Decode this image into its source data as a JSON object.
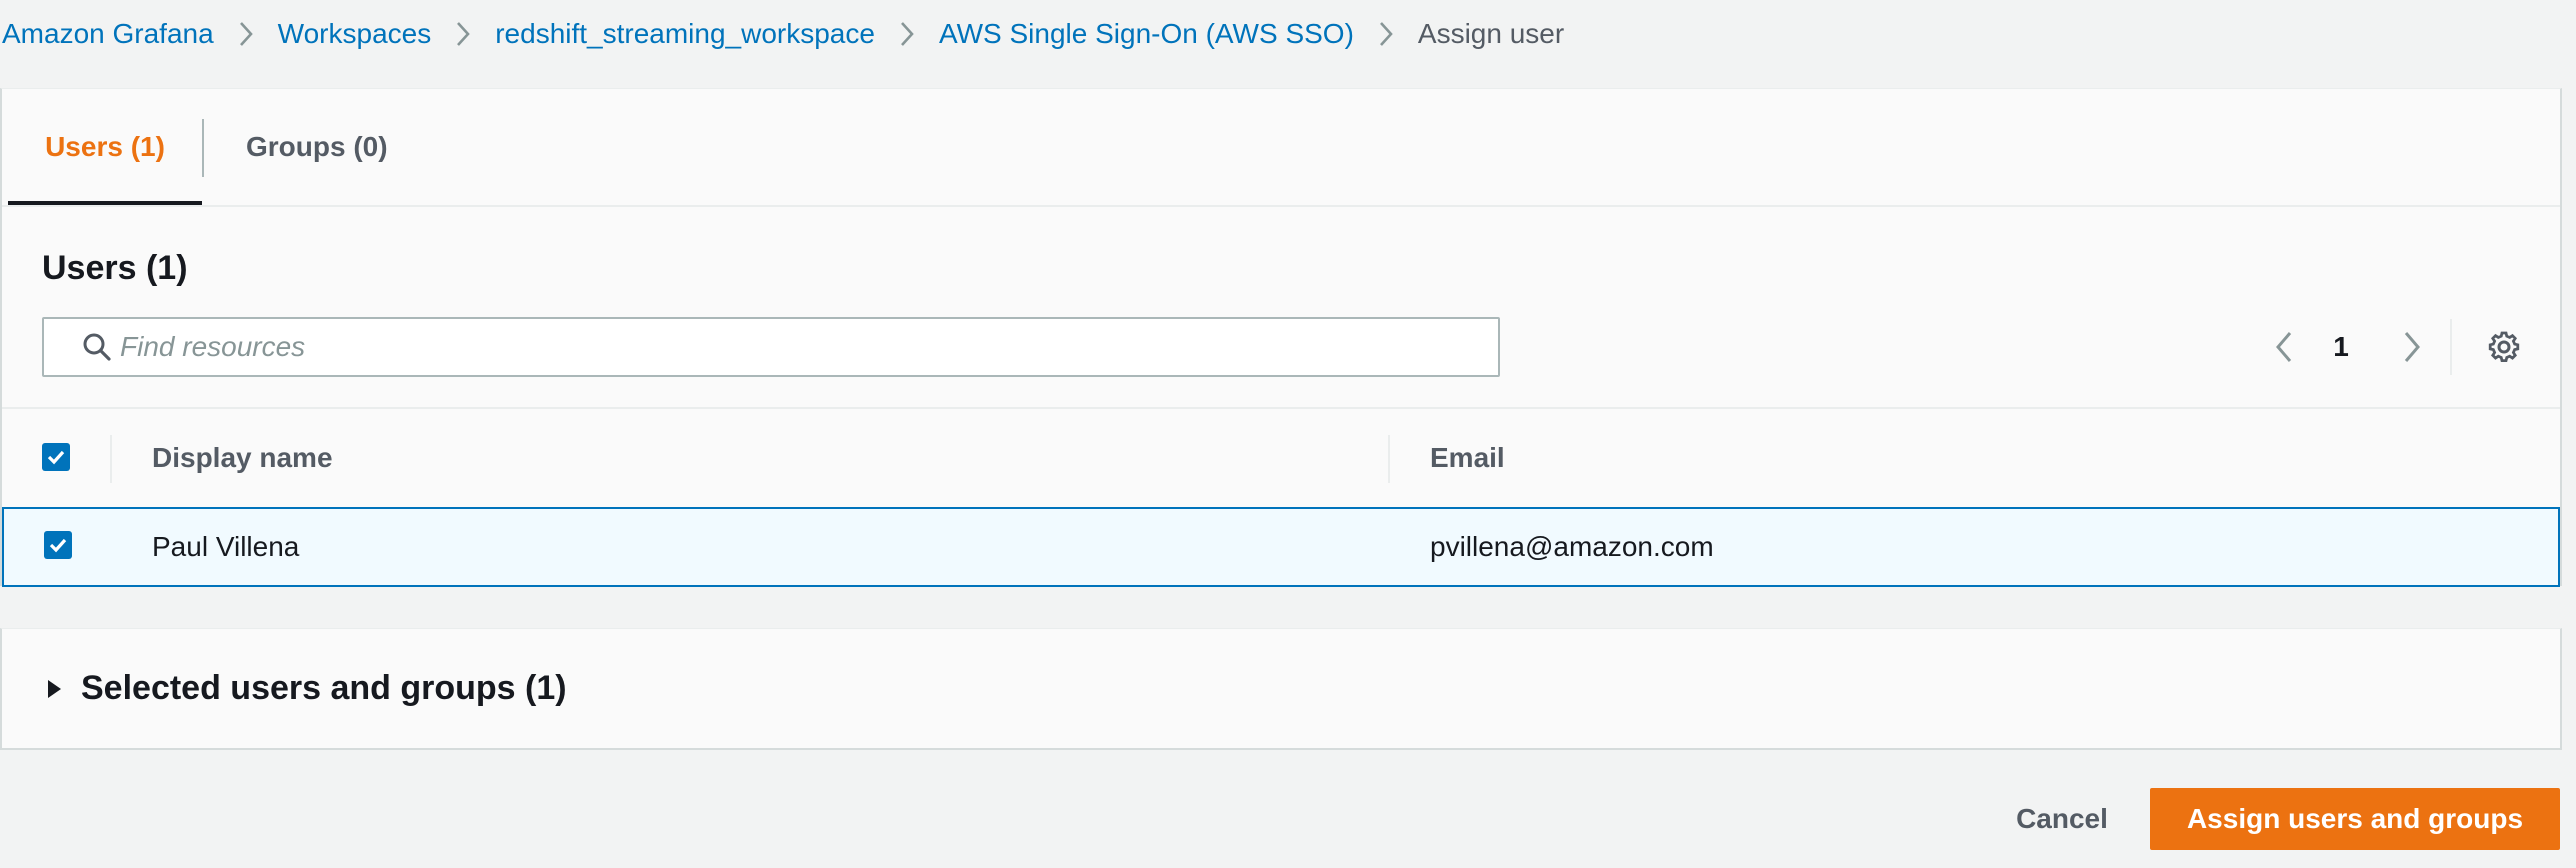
{
  "breadcrumb": {
    "items": [
      {
        "label": "Amazon Grafana"
      },
      {
        "label": "Workspaces"
      },
      {
        "label": "redshift_streaming_workspace"
      },
      {
        "label": "AWS Single Sign-On (AWS SSO)"
      }
    ],
    "current": "Assign user"
  },
  "tabs": [
    {
      "label": "Users (1)",
      "active": true
    },
    {
      "label": "Groups (0)",
      "active": false
    }
  ],
  "table": {
    "title": "Users (1)",
    "search": {
      "placeholder": "Find resources",
      "value": ""
    },
    "pagination": {
      "current_page": "1"
    },
    "columns": [
      "Display name",
      "Email"
    ],
    "select_all_checked": true,
    "rows": [
      {
        "display_name": "Paul Villena",
        "email": "pvillena@amazon.com",
        "selected": true
      }
    ]
  },
  "selected_section": {
    "title": "Selected users and groups (1)",
    "expanded": false
  },
  "actions": {
    "cancel": "Cancel",
    "assign": "Assign users and groups"
  },
  "colors": {
    "link": "#0073bb",
    "accent": "#ec7211",
    "selected_row_bg": "#f1faff",
    "page_bg": "#f2f3f3"
  },
  "icons": [
    "chevron-right-icon",
    "search-icon",
    "chevron-left-icon",
    "settings-gear-icon",
    "checkmark-icon",
    "caret-right-icon"
  ]
}
